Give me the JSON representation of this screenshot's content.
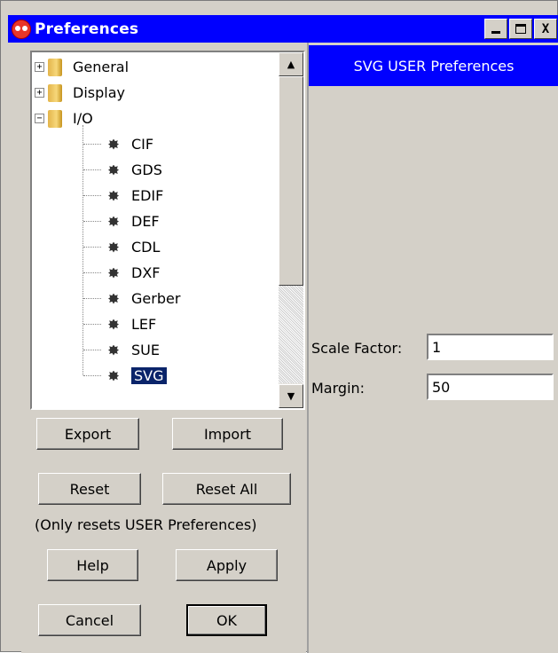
{
  "window": {
    "title": "Preferences",
    "controls": {
      "minimize": "_",
      "maximize": "□",
      "close": "X"
    }
  },
  "tree": {
    "nodes": [
      {
        "label": "General",
        "type": "folder",
        "expander": "+"
      },
      {
        "label": "Display",
        "type": "folder",
        "expander": "+"
      },
      {
        "label": "I/O",
        "type": "folder",
        "expander": "−"
      },
      {
        "label": "CIF",
        "type": "leaf"
      },
      {
        "label": "GDS",
        "type": "leaf"
      },
      {
        "label": "EDIF",
        "type": "leaf"
      },
      {
        "label": "DEF",
        "type": "leaf"
      },
      {
        "label": "CDL",
        "type": "leaf"
      },
      {
        "label": "DXF",
        "type": "leaf"
      },
      {
        "label": "Gerber",
        "type": "leaf"
      },
      {
        "label": "LEF",
        "type": "leaf"
      },
      {
        "label": "SUE",
        "type": "leaf"
      },
      {
        "label": "SVG",
        "type": "leaf",
        "selected": true
      }
    ],
    "scroll_up": "▲",
    "scroll_down": "▼"
  },
  "buttons": {
    "export": "Export",
    "import": "Import",
    "reset": "Reset",
    "reset_all": "Reset All",
    "reset_note": "(Only resets USER Preferences)",
    "help": "Help",
    "apply": "Apply",
    "cancel": "Cancel",
    "ok": "OK"
  },
  "panel": {
    "header": "SVG USER Preferences",
    "scale_factor": {
      "label": "Scale Factor:",
      "value": "1"
    },
    "margin": {
      "label": "Margin:",
      "value": "50"
    }
  },
  "colors": {
    "titlebar": "#0000ff",
    "panel_header": "#0000ff",
    "selection": "#0a246a",
    "background": "#d4d0c8"
  }
}
